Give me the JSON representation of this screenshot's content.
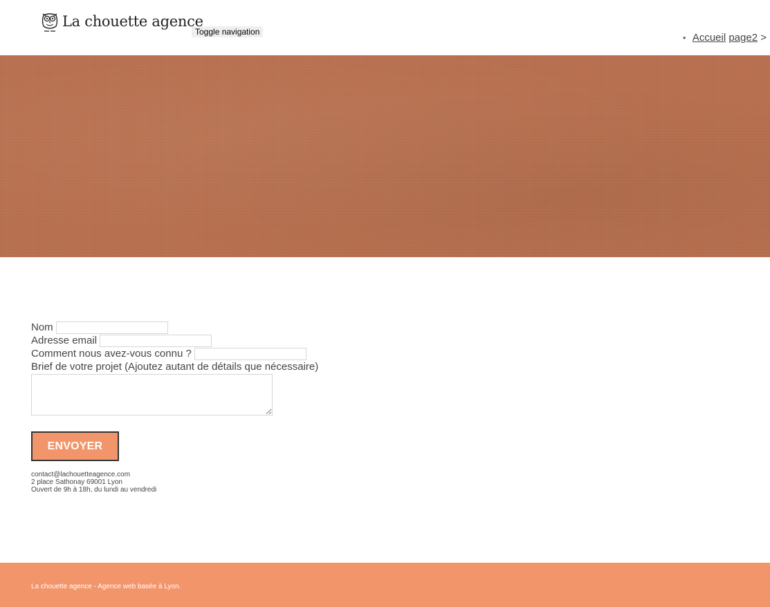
{
  "header": {
    "brand_name": "La chouette agence",
    "logo_icon": "owl-icon",
    "toggle_label": "Toggle navigation",
    "nav": {
      "items": [
        {
          "label": "Accueil"
        },
        {
          "label": "page2"
        }
      ],
      "separator": " >"
    }
  },
  "hero": {
    "background_color": "#b97150"
  },
  "form": {
    "name_label": "Nom",
    "email_label": "Adresse email",
    "source_label": "Comment nous avez-vous connu ?",
    "brief_label": "Brief de votre projet (Ajoutez autant de détails que nécessaire)",
    "submit_label": "ENVOYER",
    "submit_color": "#f2956a"
  },
  "contact": {
    "email": "contact@lachouetteagence.com",
    "address": "2 place Sathonay 69001 Lyon",
    "hours": "Ouvert de 9h à 18h, du lundi au vendredi"
  },
  "footer": {
    "text": "La chouette agence - Agence web basée à Lyon.",
    "background_color": "#f2956a"
  }
}
